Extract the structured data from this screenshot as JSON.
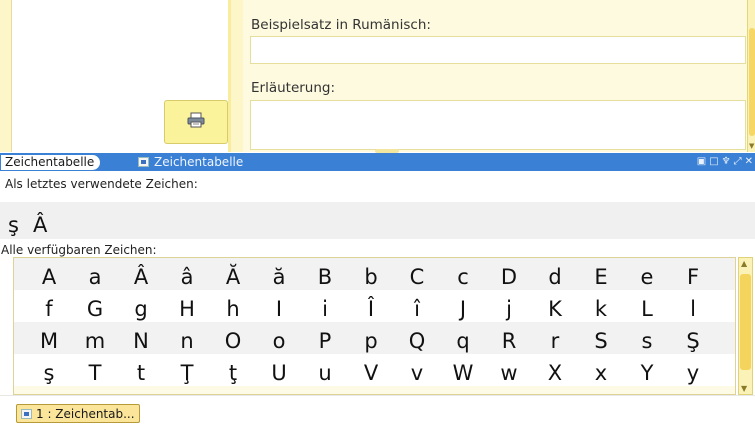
{
  "form": {
    "example_label": "Beispielsatz in Rumänisch:",
    "example_value": "",
    "explanation_label": "Erläuterung:",
    "explanation_value": ""
  },
  "dock": {
    "active_tab": "Zeichentabelle",
    "inactive_tab": "Zeichentabelle",
    "buttons": [
      "▣",
      "□",
      "♆",
      "⤢",
      "✕"
    ]
  },
  "recent": {
    "label": "Als letztes verwendete Zeichen:",
    "chars": [
      "ş",
      "Â"
    ]
  },
  "all": {
    "label": "Alle verfügbaren Zeichen:",
    "rows": [
      [
        "A",
        "a",
        "Â",
        "â",
        "Ă",
        "ă",
        "B",
        "b",
        "C",
        "c",
        "D",
        "d",
        "E",
        "e",
        "F"
      ],
      [
        "f",
        "G",
        "g",
        "H",
        "h",
        "I",
        "i",
        "Î",
        "î",
        "J",
        "j",
        "K",
        "k",
        "L",
        "l"
      ],
      [
        "M",
        "m",
        "N",
        "n",
        "O",
        "o",
        "P",
        "p",
        "Q",
        "q",
        "R",
        "r",
        "S",
        "s",
        "Ş"
      ],
      [
        "ş",
        "T",
        "t",
        "Ţ",
        "ţ",
        "U",
        "u",
        "V",
        "v",
        "W",
        "w",
        "X",
        "x",
        "Y",
        "y"
      ]
    ]
  },
  "taskbar": {
    "button_label": "1 : Zeichentab..."
  },
  "colors": {
    "dock_bar": "#3a80d4",
    "form_bg": "#fdfadf",
    "accent_yellow": "#f5d45e"
  },
  "icons": {
    "print": "print-icon",
    "window": "window-icon"
  }
}
